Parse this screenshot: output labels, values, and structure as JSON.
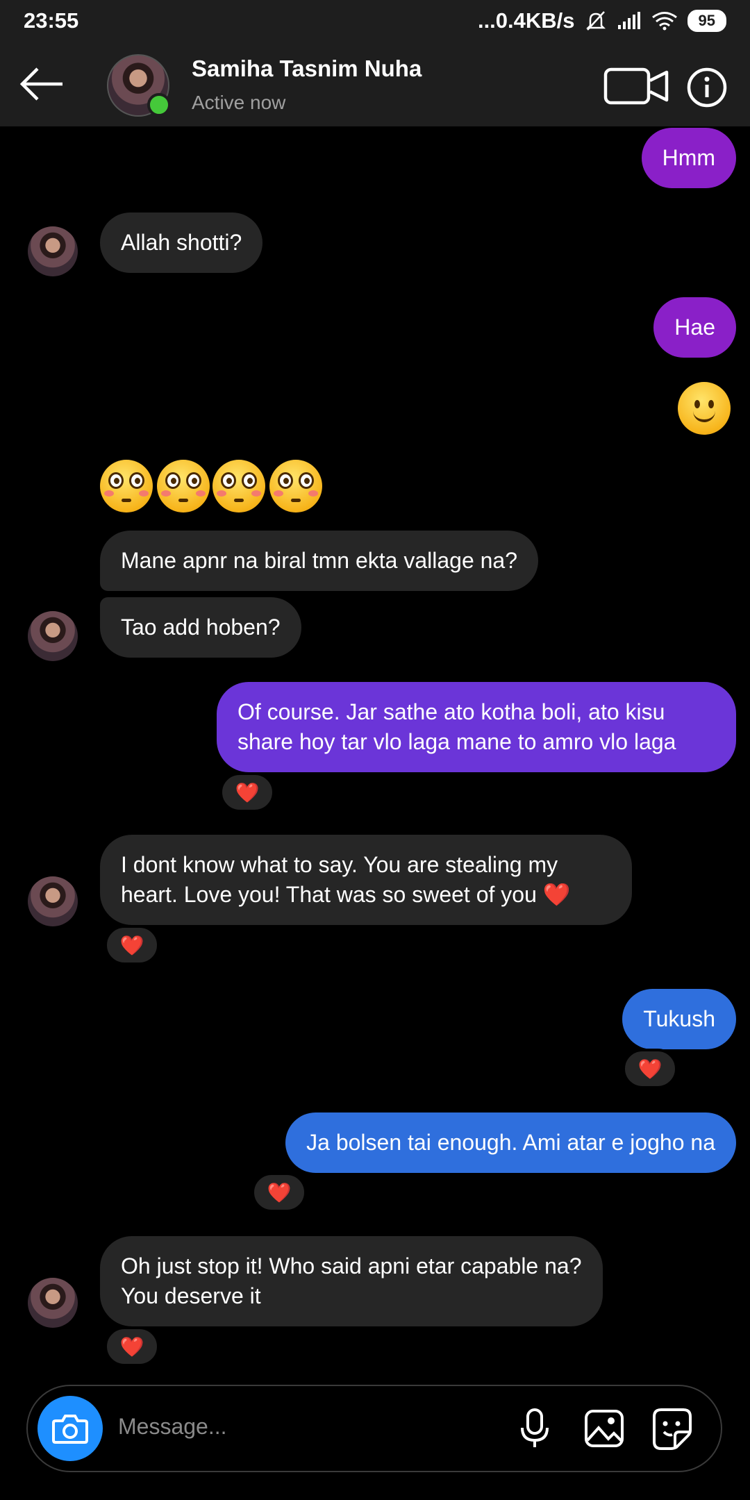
{
  "status_bar": {
    "time": "23:55",
    "network_speed": "...0.4KB/s",
    "battery": "95"
  },
  "header": {
    "name": "Samiha Tasnim Nuha",
    "status": "Active now"
  },
  "messages": [
    {
      "dir": "out",
      "text": "Hmm"
    },
    {
      "dir": "in",
      "text": "Allah shotti?"
    },
    {
      "dir": "out",
      "text": "Hae"
    },
    {
      "dir": "out",
      "text": "🙂"
    },
    {
      "dir": "in",
      "text": "😳😳😳😳"
    },
    {
      "dir": "in",
      "text": "Mane apnr na biral tmn ekta vallage na?"
    },
    {
      "dir": "in",
      "text": "Tao add hoben?"
    },
    {
      "dir": "out",
      "text": "Of course. Jar sathe ato kotha boli, ato kisu share hoy tar vlo laga mane to amro vlo laga",
      "reaction": "❤️"
    },
    {
      "dir": "in",
      "text": "I dont know what to say. You are stealing my heart. Love you! That was so sweet of you ❤️",
      "reaction": "❤️"
    },
    {
      "dir": "out",
      "text": "Tukush",
      "reaction": "❤️"
    },
    {
      "dir": "out",
      "text": "Ja bolsen tai enough. Ami atar e jogho na",
      "reaction": "❤️"
    },
    {
      "dir": "in",
      "text": "Oh just stop it! Who said apni etar capable na? You deserve it",
      "reaction": "❤️"
    }
  ],
  "composer": {
    "placeholder": "Message..."
  },
  "icons": {
    "back": "arrow-left-icon",
    "video": "video-camera-icon",
    "info": "info-icon",
    "camera": "camera-icon",
    "mic": "microphone-icon",
    "gallery": "image-icon",
    "sticker": "sticker-icon"
  },
  "colors": {
    "bubble_in": "#262626",
    "bubble_out_purple": "#8a20c8",
    "bubble_out_violet": "#6b35d8",
    "bubble_out_blue": "#2f6fdd",
    "online": "#45c93a",
    "camera_button": "#1e8fff"
  }
}
